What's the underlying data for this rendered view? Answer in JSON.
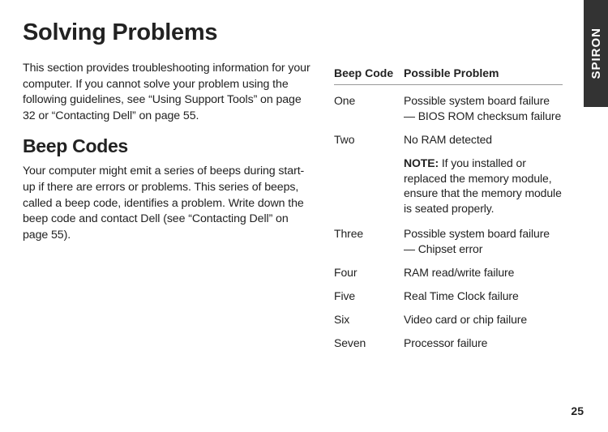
{
  "sideTab": "SPIRON",
  "title": "Solving Problems",
  "intro": "This section provides troubleshooting information for your computer. If you cannot solve your problem using the following guidelines, see “Using Support Tools” on page 32 or “Contacting Dell” on page 55.",
  "subheading": "Beep Codes",
  "beepIntro": "Your computer might emit a series of beeps during start-up if there are errors or problems. This series of beeps, called a beep code, identifies a problem. Write down the beep code and contact Dell (see “Contacting Dell” on page 55).",
  "tableHead": {
    "code": "Beep Code",
    "problem": "Possible Problem"
  },
  "rows": [
    {
      "code": "One",
      "problem": "Possible system board failure — BIOS ROM checksum failure"
    },
    {
      "code": "Two",
      "problem": "No RAM detected"
    },
    {
      "code": "",
      "problem": "",
      "noteLabel": "NOTE:",
      "noteText": " If you installed or replaced the memory module, ensure that the memory module is seated properly."
    },
    {
      "code": "Three",
      "problem": "Possible system board failure — Chipset error"
    },
    {
      "code": "Four",
      "problem": "RAM read/write failure"
    },
    {
      "code": "Five",
      "problem": "Real Time Clock failure"
    },
    {
      "code": "Six",
      "problem": "Video card or chip failure"
    },
    {
      "code": "Seven",
      "problem": "Processor failure"
    }
  ],
  "pageNumber": "25"
}
